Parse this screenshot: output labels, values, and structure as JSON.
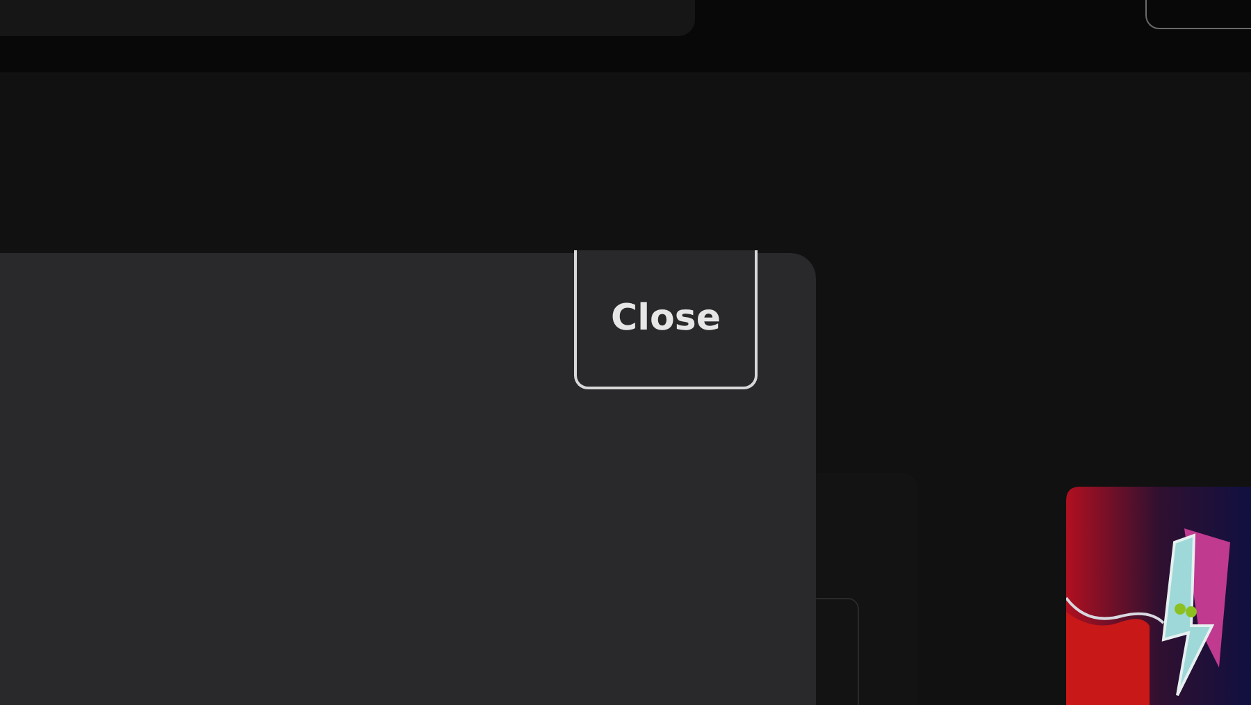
{
  "dialog": {
    "close_button": "Close"
  }
}
